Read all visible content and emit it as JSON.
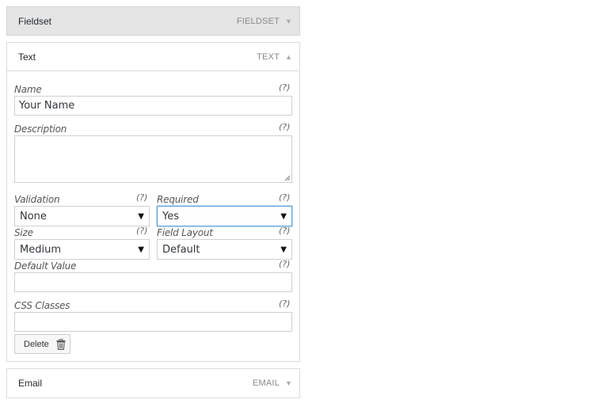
{
  "panels": {
    "fieldset": {
      "title": "Fieldset",
      "type": "FIELDSET",
      "arrow": "▼"
    },
    "text": {
      "title": "Text",
      "type": "TEXT",
      "arrow": "▲"
    },
    "email": {
      "title": "Email",
      "type": "EMAIL",
      "arrow": "▼"
    }
  },
  "help_text": "(?)",
  "form": {
    "name": {
      "label": "Name",
      "value": "Your Name"
    },
    "description": {
      "label": "Description",
      "value": ""
    },
    "validation": {
      "label": "Validation",
      "value": "None"
    },
    "required": {
      "label": "Required",
      "value": "Yes"
    },
    "size": {
      "label": "Size",
      "value": "Medium"
    },
    "field_layout": {
      "label": "Field Layout",
      "value": "Default"
    },
    "default_value": {
      "label": "Default Value",
      "value": ""
    },
    "css_classes": {
      "label": "CSS Classes",
      "value": ""
    },
    "delete_label": "Delete"
  },
  "icons": {
    "caret": "caret-down-icon",
    "delete": "trash-icon",
    "resize": "resize-grip-icon"
  }
}
